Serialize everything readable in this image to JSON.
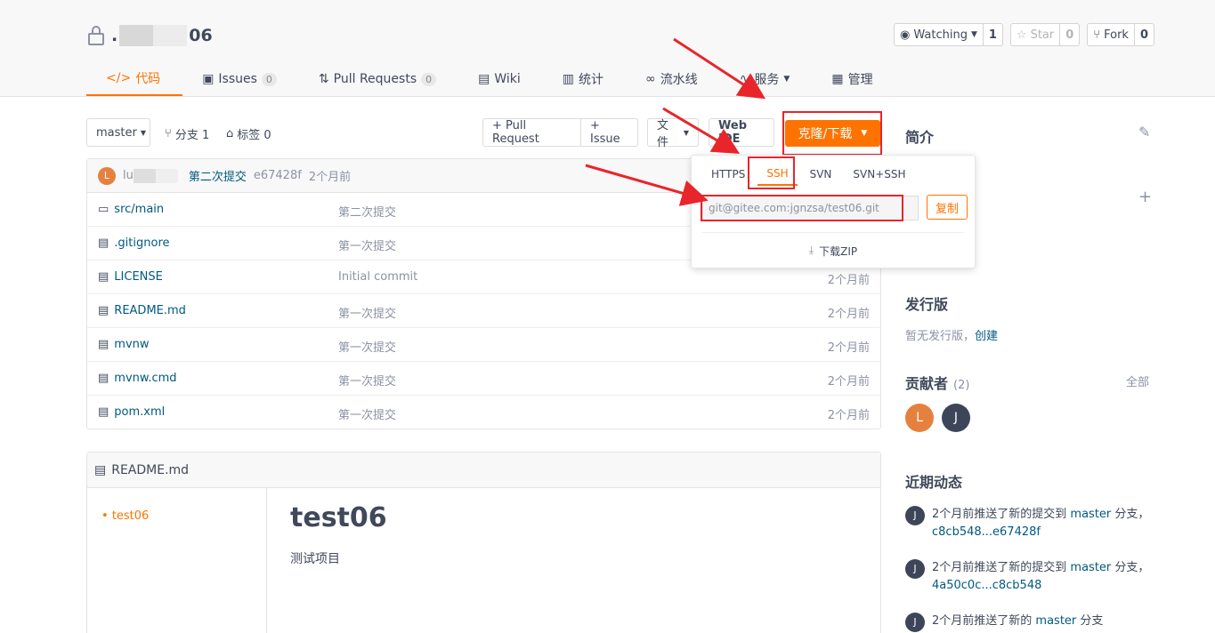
{
  "repo": {
    "name_prefix": ".",
    "name_suffix": "06"
  },
  "actions": {
    "watch_label": "Watching",
    "watch_count": "1",
    "star_label": "Star",
    "star_count": "0",
    "fork_label": "Fork",
    "fork_count": "0"
  },
  "nav": {
    "tabs": [
      {
        "label": "代码"
      },
      {
        "label": "Issues",
        "badge": "0"
      },
      {
        "label": "Pull Requests",
        "badge": "0"
      },
      {
        "label": "Wiki"
      },
      {
        "label": "统计"
      },
      {
        "label": "流水线"
      },
      {
        "label": "服务"
      },
      {
        "label": "管理"
      }
    ]
  },
  "toolbar": {
    "branch": "master",
    "branches_label": "分支 1",
    "tags_label": "标签 0",
    "pull_request": "+ Pull Request",
    "issue": "+ Issue",
    "file": "文件",
    "webide": "Web IDE",
    "clone": "克隆/下载"
  },
  "commit": {
    "avatar": "L",
    "author": "lu",
    "message": "第二次提交",
    "hash": "e67428f",
    "time": "2个月前"
  },
  "files": [
    {
      "name": "src/main",
      "msg": "第二次提交",
      "time": "",
      "type": "folder"
    },
    {
      "name": ".gitignore",
      "msg": "第一次提交",
      "time": "",
      "type": "file"
    },
    {
      "name": "LICENSE",
      "msg": "Initial commit",
      "time": "2个月前",
      "type": "file"
    },
    {
      "name": "README.md",
      "msg": "第一次提交",
      "time": "2个月前",
      "type": "file"
    },
    {
      "name": "mvnw",
      "msg": "第一次提交",
      "time": "2个月前",
      "type": "file"
    },
    {
      "name": "mvnw.cmd",
      "msg": "第一次提交",
      "time": "2个月前",
      "type": "file"
    },
    {
      "name": "pom.xml",
      "msg": "第一次提交",
      "time": "2个月前",
      "type": "file"
    }
  ],
  "readme": {
    "file": "README.md",
    "toc_item": "test06",
    "title": "test06",
    "body": "测试项目"
  },
  "clone_dropdown": {
    "tabs": [
      "HTTPS",
      "SSH",
      "SVN",
      "SVN+SSH"
    ],
    "active_tab": "SSH",
    "url": "git@gitee.com:jgnzsa/test06.git",
    "copy": "复制",
    "zip": "下载ZIP"
  },
  "sidebar": {
    "intro": "简介",
    "release_title": "发行版",
    "release_none": "暂无发行版，",
    "release_create": "创建",
    "contributors_title": "贡献者",
    "contributors_count": "(2)",
    "contributors_all": "全部",
    "contributors": [
      {
        "initial": "L",
        "color": "#e5813e"
      },
      {
        "initial": "J",
        "color": "#3d4659"
      }
    ],
    "activity_title": "近期动态",
    "activities": [
      {
        "initial": "J",
        "prefix": "2个月前推送了新的提交到",
        "branch": "master",
        "suffix": "分支，",
        "range": "c8cb548...e67428f"
      },
      {
        "initial": "J",
        "prefix": "2个月前推送了新的提交到",
        "branch": "master",
        "suffix": "分支，",
        "range": "4a50c0c...c8cb548"
      },
      {
        "initial": "J",
        "prefix": "2个月前推送了新的",
        "branch": "master",
        "suffix": "分支",
        "range": ""
      }
    ]
  },
  "colors": {
    "accent": "#fe7300",
    "link": "#005980",
    "annotation": "#e8252b"
  }
}
